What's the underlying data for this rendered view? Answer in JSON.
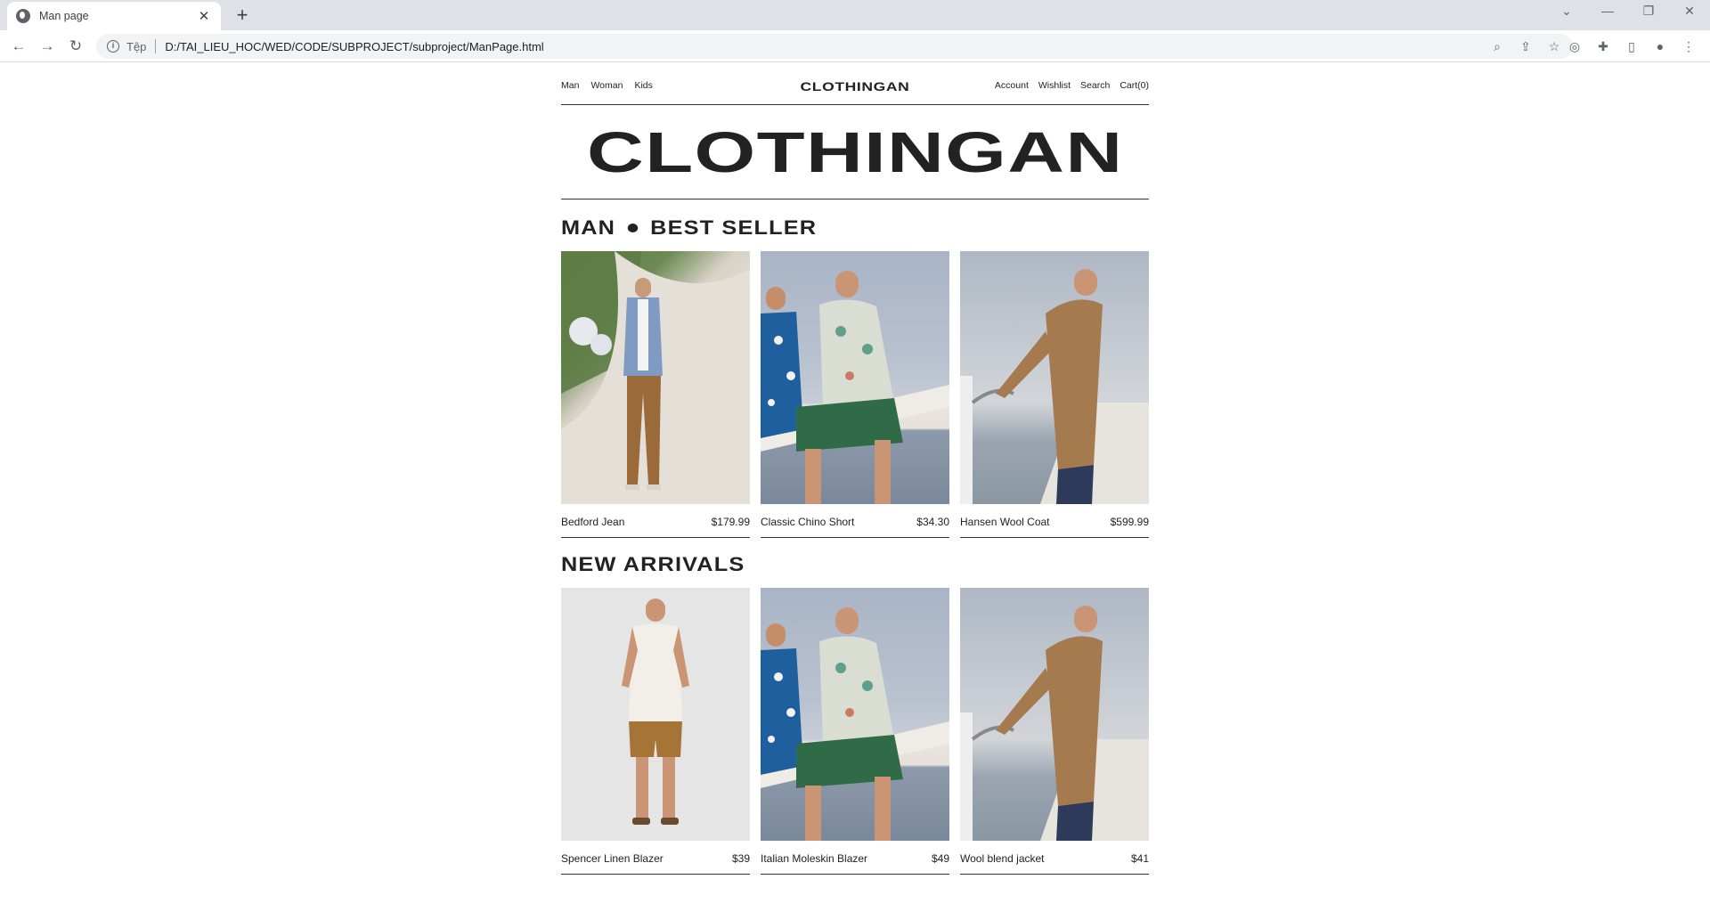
{
  "browser": {
    "tab_title": "Man page",
    "tab_close": "✕",
    "new_tab": "+",
    "scheme_label": "Tệp",
    "url": "D:/TAI_LIEU_HOC/WED/CODE/SUBPROJECT/subproject/ManPage.html"
  },
  "site": {
    "nav_left": [
      "Man",
      "Woman",
      "Kids"
    ],
    "brand": "CLOTHINGAN",
    "nav_right": [
      "Account",
      "Wishlist",
      "Search",
      "Cart(0)"
    ],
    "hero_title": "CLOTHINGAN"
  },
  "sections": [
    {
      "title_part1": "MAN",
      "title_part2": "BEST SELLER",
      "products": [
        {
          "name": "Bedford Jean",
          "price": "$179.99",
          "photo": "man-standing-plaid-shirt"
        },
        {
          "name": "Classic Chino Short",
          "price": "$34.30",
          "photo": "two-men-sitting-floral-shirts"
        },
        {
          "name": "Hansen Wool Coat",
          "price": "$599.99",
          "photo": "man-camel-coat-pier"
        }
      ]
    },
    {
      "title": "NEW ARRIVALS",
      "products": [
        {
          "name": "Spencer Linen Blazer",
          "price": "$39",
          "photo": "man-white-tee-shorts"
        },
        {
          "name": "Italian Moleskin Blazer",
          "price": "$49",
          "photo": "two-men-sitting-floral-shirts"
        },
        {
          "name": "Wool blend jacket",
          "price": "$41",
          "photo": "man-camel-coat-pier"
        }
      ]
    }
  ],
  "colors": {
    "ink": "#222222",
    "chrome_bg": "#dee1e6",
    "omnibox_bg": "#f1f3f4"
  }
}
